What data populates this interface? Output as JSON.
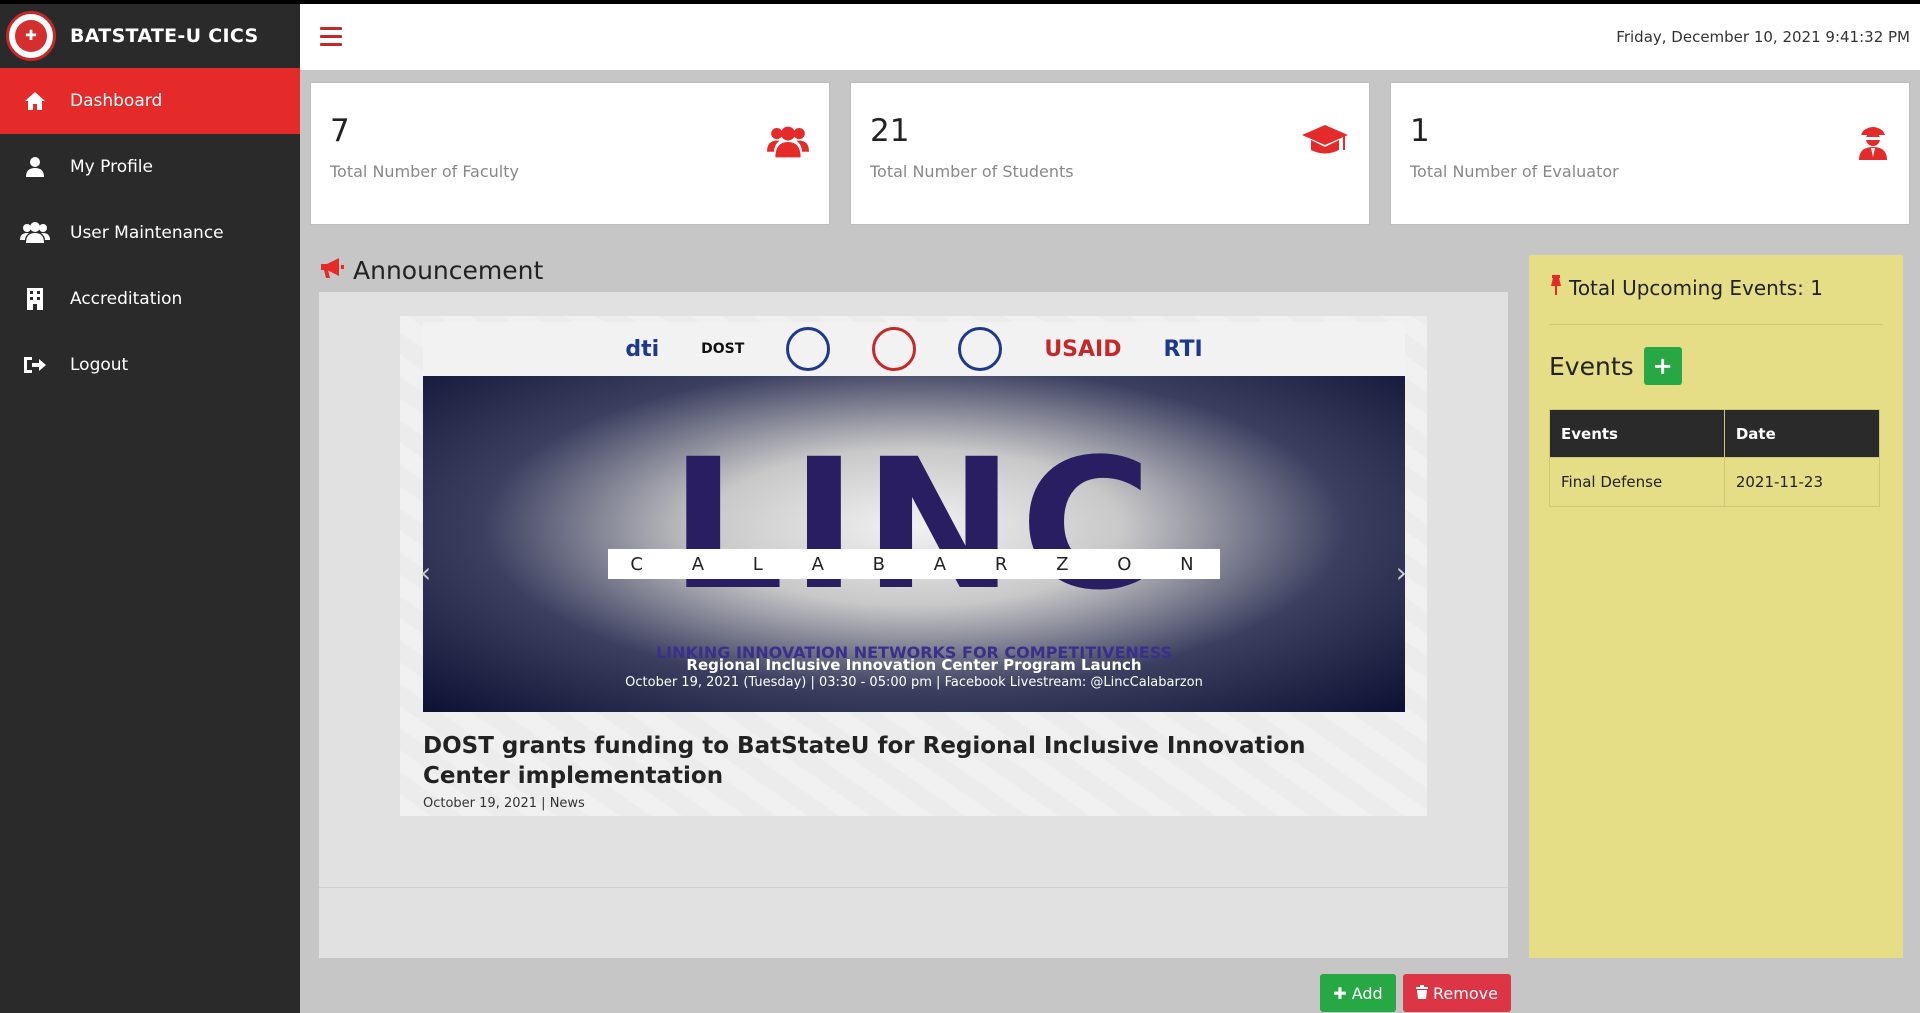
{
  "brand": {
    "title": "BATSTATE-U CICS"
  },
  "sidebar": {
    "items": [
      {
        "label": "Dashboard",
        "icon": "home-icon",
        "active": true
      },
      {
        "label": "My Profile",
        "icon": "user-icon"
      },
      {
        "label": "User Maintenance",
        "icon": "users-icon"
      },
      {
        "label": "Accreditation",
        "icon": "building-icon"
      },
      {
        "label": "Logout",
        "icon": "sign-out-icon"
      }
    ]
  },
  "topbar": {
    "datetime": "Friday, December 10, 2021 9:41:32 PM"
  },
  "stats": [
    {
      "value": "7",
      "label": "Total Number of Faculty",
      "icon": "users-icon"
    },
    {
      "value": "21",
      "label": "Total Number of Students",
      "icon": "graduation-cap-icon"
    },
    {
      "value": "1",
      "label": "Total Number of Evaluator",
      "icon": "user-secret-icon"
    }
  ],
  "announcement": {
    "title": "Announcement",
    "slide": {
      "banner_logos": [
        "dti",
        "DOST",
        "USAID",
        "RTI"
      ],
      "banner_word": "LINC",
      "banner_sub": [
        "C",
        "A",
        "L",
        "A",
        "B",
        "A",
        "R",
        "Z",
        "O",
        "N"
      ],
      "banner_tagline": "LINKING INNOVATION NETWORKS FOR COMPETITIVENESS",
      "banner_line1": "Regional Inclusive Innovation Center Program Launch",
      "banner_line2": "October 19, 2021 (Tuesday)  |  03:30 - 05:00 pm  |  Facebook Livestream: @LincCalabarzon",
      "headline": "DOST grants funding to BatStateU for Regional Inclusive Innovation Center implementation",
      "meta": "October 19, 2021 | News"
    },
    "add_label": "Add",
    "remove_label": "Remove"
  },
  "events": {
    "upcoming_label": "Total Upcoming Events: 1",
    "title": "Events",
    "plus_label": "+",
    "columns": [
      "Events",
      "Date"
    ],
    "rows": [
      {
        "event": "Final Defense",
        "date": "2021-11-23"
      }
    ]
  },
  "colors": {
    "accent": "#e52a2a",
    "sidebar": "#2a2a2a",
    "events_bg": "#e6de86",
    "success": "#28a745",
    "danger": "#dc3545"
  }
}
